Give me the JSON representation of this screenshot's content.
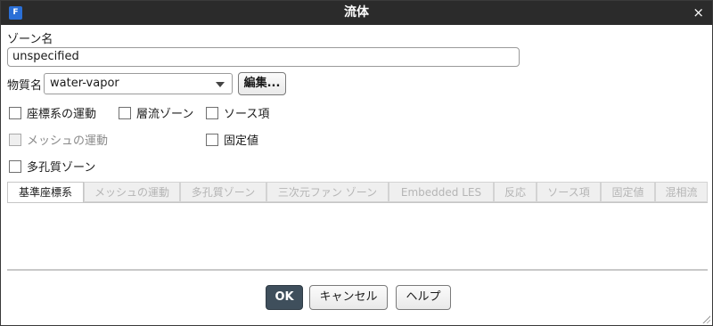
{
  "window": {
    "title": "流体",
    "icon_label": "F",
    "close_glyph": "×"
  },
  "zone_name": {
    "label": "ゾーン名",
    "value": "unspecified"
  },
  "material": {
    "label": "物質名",
    "selected": "water-vapor",
    "edit_button": "編集..."
  },
  "options": {
    "frame_motion": {
      "label": "座標系の運動",
      "checked": false,
      "enabled": true
    },
    "laminar_zone": {
      "label": "層流ゾーン",
      "checked": false,
      "enabled": true
    },
    "source_terms": {
      "label": "ソース項",
      "checked": false,
      "enabled": true
    },
    "mesh_motion": {
      "label": "メッシュの運動",
      "checked": false,
      "enabled": false
    },
    "fixed_values": {
      "label": "固定値",
      "checked": false,
      "enabled": true
    },
    "porous_zone": {
      "label": "多孔質ゾーン",
      "checked": false,
      "enabled": true
    }
  },
  "tabs": [
    {
      "label": "基準座標系",
      "active": true
    },
    {
      "label": "メッシュの運動",
      "active": false
    },
    {
      "label": "多孔質ゾーン",
      "active": false
    },
    {
      "label": "三次元ファン ゾーン",
      "active": false
    },
    {
      "label": "Embedded LES",
      "active": false
    },
    {
      "label": "反応",
      "active": false
    },
    {
      "label": "ソース項",
      "active": false
    },
    {
      "label": "固定値",
      "active": false
    },
    {
      "label": "混相流",
      "active": false
    }
  ],
  "buttons": {
    "ok": "OK",
    "cancel": "キャンセル",
    "help": "ヘルプ"
  }
}
